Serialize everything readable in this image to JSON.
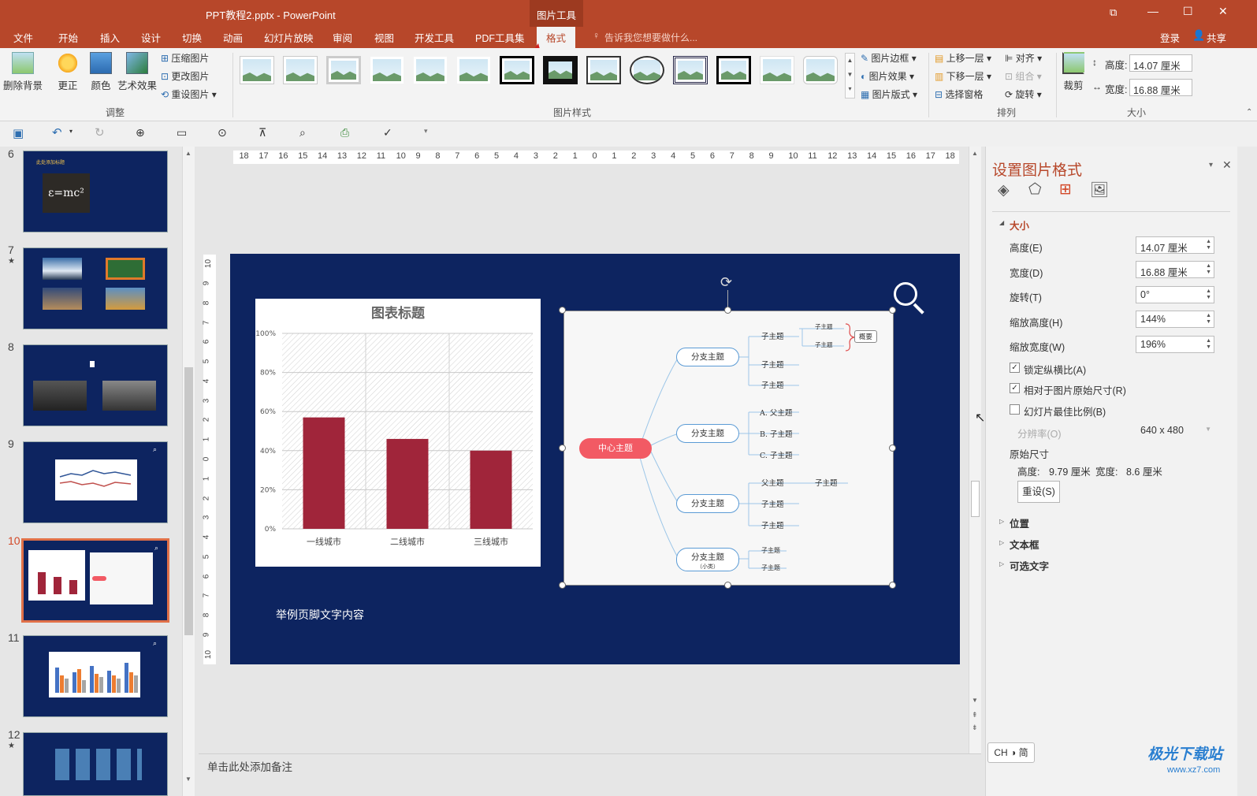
{
  "window": {
    "title": "PPT教程2.pptx - PowerPoint",
    "context_tool": "图片工具",
    "controls": [
      "⧉",
      "—",
      "☐",
      "✕"
    ]
  },
  "tabs": [
    "文件",
    "开始",
    "插入",
    "设计",
    "切换",
    "动画",
    "幻灯片放映",
    "审阅",
    "视图",
    "开发工具",
    "PDF工具集",
    "格式"
  ],
  "active_tab": "格式",
  "tell_me": "告诉我您想要做什么...",
  "login": "登录",
  "share": "共享",
  "ribbon": {
    "adjust": {
      "remove_bg": "删除背景",
      "correct": "更正",
      "color": "颜色",
      "art": "艺术效果",
      "compress": "压缩图片",
      "change": "更改图片",
      "reset": "重设图片",
      "label": "调整"
    },
    "styles": {
      "label": "图片样式",
      "border": "图片边框",
      "effects": "图片效果",
      "layout": "图片版式"
    },
    "arrange": {
      "label": "排列",
      "forward": "上移一层",
      "backward": "下移一层",
      "pane": "选择窗格",
      "align": "对齐",
      "group": "组合",
      "rotate": "旋转"
    },
    "size": {
      "label": "大小",
      "crop": "裁剪",
      "height_label": "高度:",
      "height_val": "14.07 厘米",
      "width_label": "宽度:",
      "width_val": "16.88 厘米"
    }
  },
  "thumbnails": [
    {
      "num": "6",
      "star": "",
      "caption": "此处添加标题"
    },
    {
      "num": "7",
      "star": "★",
      "caption": ""
    },
    {
      "num": "8",
      "star": "",
      "caption": ""
    },
    {
      "num": "9",
      "star": "",
      "caption": ""
    },
    {
      "num": "10",
      "star": "",
      "caption": ""
    },
    {
      "num": "11",
      "star": "",
      "caption": ""
    },
    {
      "num": "12",
      "star": "★",
      "caption": ""
    }
  ],
  "active_slide": "10",
  "ruler": {
    "h_ticks": [
      "18",
      "17",
      "16",
      "15",
      "14",
      "13",
      "12",
      "11",
      "10",
      "9",
      "8",
      "7",
      "6",
      "5",
      "4",
      "3",
      "2",
      "1",
      "0",
      "1",
      "2",
      "3",
      "4",
      "5",
      "6",
      "7",
      "8",
      "9",
      "10",
      "11",
      "12",
      "13",
      "14",
      "15",
      "16",
      "17",
      "18"
    ],
    "v_ticks": [
      "10",
      "9",
      "8",
      "7",
      "6",
      "5",
      "4",
      "3",
      "2",
      "1",
      "0",
      "1",
      "2",
      "3",
      "4",
      "5",
      "6",
      "7",
      "8",
      "9",
      "10"
    ]
  },
  "slide": {
    "footer": "举例页脚文字内容"
  },
  "chart_data": {
    "type": "bar",
    "title": "图表标题",
    "categories": [
      "一线城市",
      "二线城市",
      "三线城市"
    ],
    "values": [
      0.57,
      0.46,
      0.4
    ],
    "ylim": [
      0,
      1
    ],
    "yticks": [
      "0%",
      "20%",
      "40%",
      "60%",
      "80%",
      "100%"
    ],
    "bar_color": "#a0253a",
    "grid": true
  },
  "mindmap": {
    "center": "中心主题",
    "branches": [
      "分支主题",
      "分支主题",
      "分支主题",
      "分支主题"
    ],
    "branch4_sub": "（小类）",
    "leaves1": [
      "子主题",
      "子主题",
      "子主题"
    ],
    "leaves1_sub": [
      "子主题",
      "子主题"
    ],
    "summary": "概要",
    "leaves2": [
      "A. 父主题",
      "B. 子主题",
      "C. 子主题"
    ],
    "leaves3": [
      "父主题",
      "子主题",
      "子主题"
    ],
    "leaves3_extra": "子主题",
    "leaves4": [
      "子主题",
      "子主题"
    ]
  },
  "notes_placeholder": "单击此处添加备注",
  "panel": {
    "title": "设置图片格式",
    "section_size": "大小",
    "height_label": "高度(E)",
    "height_val": "14.07 厘米",
    "width_label": "宽度(D)",
    "width_val": "16.88 厘米",
    "rotate_label": "旋转(T)",
    "rotate_val": "0°",
    "scale_h_label": "缩放高度(H)",
    "scale_h_val": "144%",
    "scale_w_label": "缩放宽度(W)",
    "scale_w_val": "196%",
    "lock_aspect": "锁定纵横比(A)",
    "relative_orig": "相对于图片原始尺寸(R)",
    "best_scale": "幻灯片最佳比例(B)",
    "resolution_label": "分辨率(O)",
    "resolution_val": "640 x 480",
    "orig_size": "原始尺寸",
    "orig_height": "高度:",
    "orig_height_val": "9.79 厘米",
    "orig_width": "宽度:",
    "orig_width_val": "8.6 厘米",
    "reset_btn": "重设(S)",
    "section_position": "位置",
    "section_textbox": "文本框",
    "section_alttext": "可选文字"
  },
  "ime": "CH ◑ 简",
  "watermark": "极光下载站",
  "watermark_url": "www.xz7.com",
  "accent": "#b7472a"
}
